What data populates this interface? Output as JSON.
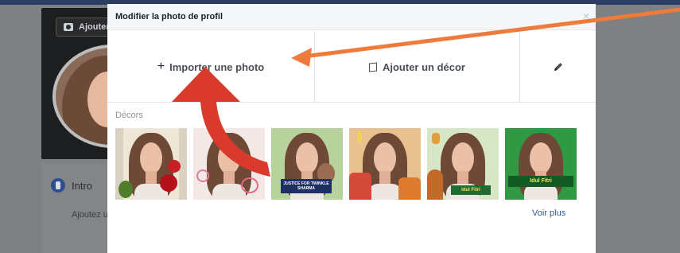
{
  "background": {
    "cover_button_label": "Ajouter",
    "intro_label": "Intro",
    "intro_hint": "Ajoutez un"
  },
  "modal": {
    "title": "Modifier la photo de profil",
    "close_glyph": "×",
    "actions": {
      "import_label": "Importer une photo",
      "import_icon": "+",
      "decor_label": "Ajouter un décor"
    },
    "decors_label": "Décors",
    "decors": [
      {
        "name": "flowers-window-frame",
        "banner": ""
      },
      {
        "name": "hearts-frame",
        "banner": ""
      },
      {
        "name": "justice-frame",
        "banner": "JUSTICE FOR TWINKLE SHARMA"
      },
      {
        "name": "lanterns-frame",
        "banner": ""
      },
      {
        "name": "eid-mosque-frame",
        "banner": "Idul Fitri"
      },
      {
        "name": "green-eid-frame",
        "banner": "Idul Fitri"
      }
    ],
    "see_more_label": "Voir plus"
  },
  "colors": {
    "accent_link": "#365899",
    "orange_arrow": "#ee7b3b",
    "red_arrow": "#d93a2b",
    "topbar": "#2c3e63"
  }
}
